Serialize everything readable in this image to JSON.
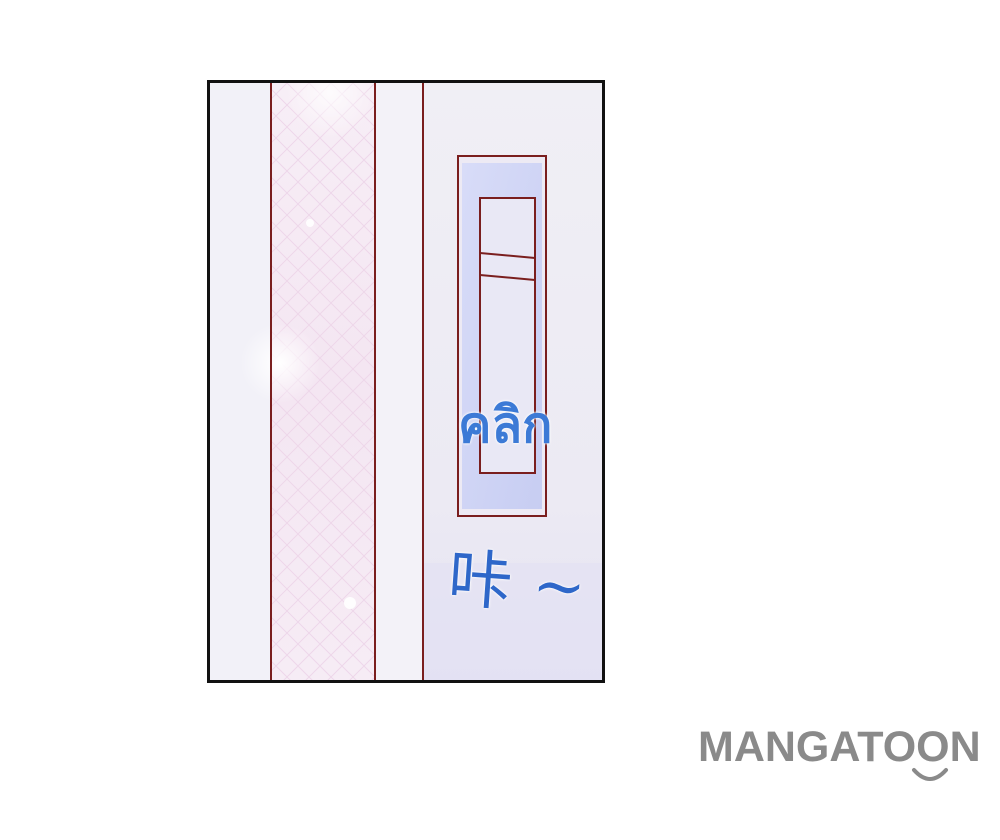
{
  "panel": {
    "sound_effect_thai": "คลิก",
    "sound_effect_chinese": "咔 ~"
  },
  "watermark": {
    "brand": "MANGATOON",
    "logo_icon": "smile-icon"
  },
  "colors": {
    "panel_border": "#111111",
    "door_frame_line": "#7a1e1e",
    "sfx_blue": "#3c7ad6",
    "watermark_gray": "#8a8a8a"
  }
}
